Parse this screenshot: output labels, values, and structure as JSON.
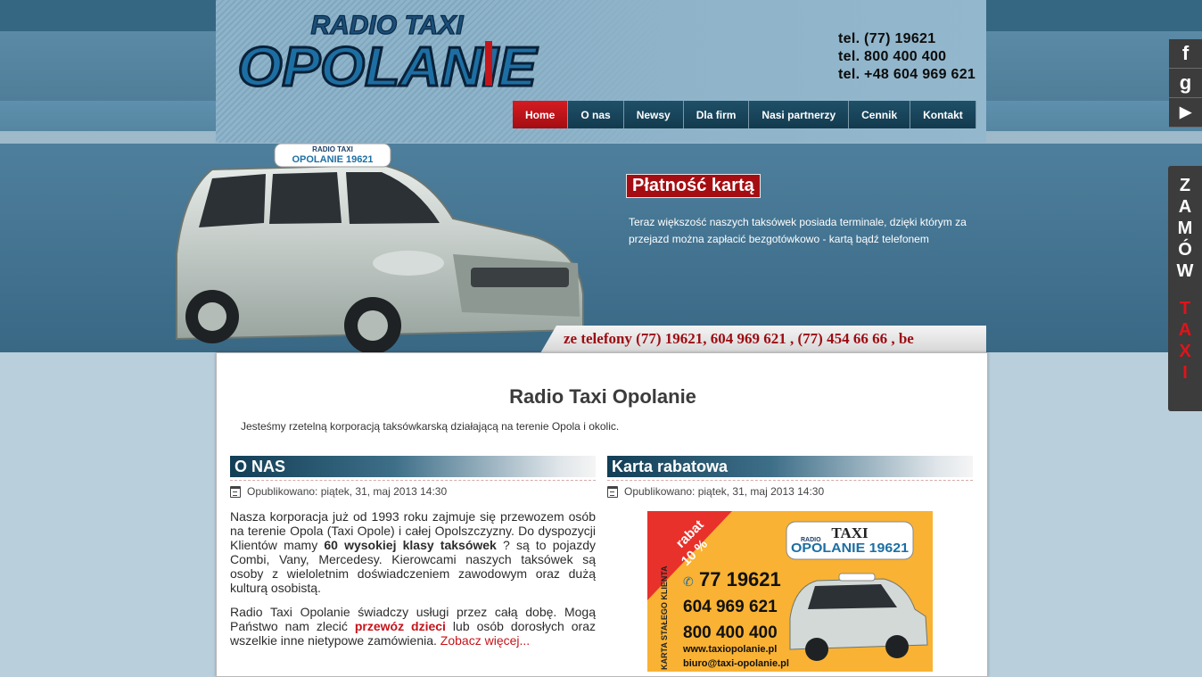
{
  "header": {
    "logo": {
      "top": "RADIO TAXI",
      "main": "OPOLANIE"
    },
    "phones": [
      "tel. (77) 19621",
      "tel. 800 400 400",
      "tel. +48 604 969 621"
    ]
  },
  "social": [
    {
      "icon": "facebook-icon",
      "glyph": "f"
    },
    {
      "icon": "google-icon",
      "glyph": "g"
    },
    {
      "icon": "youtube-play-icon",
      "glyph": "▶"
    }
  ],
  "nav": {
    "items": [
      {
        "label": "Home",
        "active": true
      },
      {
        "label": "O nas"
      },
      {
        "label": "Newsy"
      },
      {
        "label": "Dla firm"
      },
      {
        "label": "Nasi partnerzy"
      },
      {
        "label": "Cennik"
      },
      {
        "label": "Kontakt"
      }
    ]
  },
  "promo": {
    "title": "Płatność kartą",
    "text": "Teraz większość naszych taksówek posiada terminale, dzięki którym za przejazd można zapłacić bezgotówkowo - kartą bądź telefonem"
  },
  "ticker": "ze telefony (77) 19621, 604 969 621 , (77) 454 66 66 , be",
  "car_sign": {
    "line1": "RADIO TAXI",
    "line2": "OPOLANIE 19621"
  },
  "order_tab": {
    "word1": [
      "Z",
      "A",
      "M",
      "Ó",
      "W"
    ],
    "word2": [
      "T",
      "A",
      "X",
      "I"
    ]
  },
  "content": {
    "title": "Radio Taxi Opolanie",
    "intro": "Jesteśmy rzetelną korporacją taksówkarską działającą na terenie Opola i okolic.",
    "left": {
      "heading": "O NAS",
      "meta": "Opublikowano: piątek, 31, maj 2013 14:30",
      "p1_a": "Nasza korporacja już od 1993 roku zajmuje się przewozem osób na terenie Opola (Taxi Opole) i całej Opolszczyzny. Do dyspozycji Klientów mamy ",
      "p1_b": "60 wysokiej klasy taksówek",
      "p1_c": " ? są to pojazdy Combi, Vany, Mercedesy. Kierowcami naszych taksówek są osoby z wieloletnim doświadczeniem zawodowym oraz dużą kulturą osobistą.",
      "p2_a": "Radio Taxi Opolanie świadczy usługi przez całą dobę. Mogą Państwo nam zlecić ",
      "p2_b": "przewóz dzieci",
      "p2_c": " lub osób dorosłych oraz wszelkie inne nietypowe zamówienia. ",
      "more": "Zobacz więcej..."
    },
    "right": {
      "heading": "Karta rabatowa",
      "meta": "Opublikowano: piątek, 31, maj 2013 14:30",
      "card": {
        "badge1": "rabat",
        "badge2": "10 %",
        "brand_small": "RADIO",
        "brand_top": "TAXI",
        "brand_main": "OPOLANIE 19621",
        "side": "KARTA STAŁEGO KLIENTA",
        "phone1": "77 19621",
        "phone2": "604 969 621",
        "phone3": "800 400 400",
        "web": "www.taxiopolanie.pl",
        "email": "biuro@taxi-opolanie.pl"
      }
    }
  },
  "colors": {
    "accent_red": "#a50d12",
    "nav_dark": "#133a4e",
    "heading_dark": "#123e56",
    "card_orange": "#f9b233"
  }
}
